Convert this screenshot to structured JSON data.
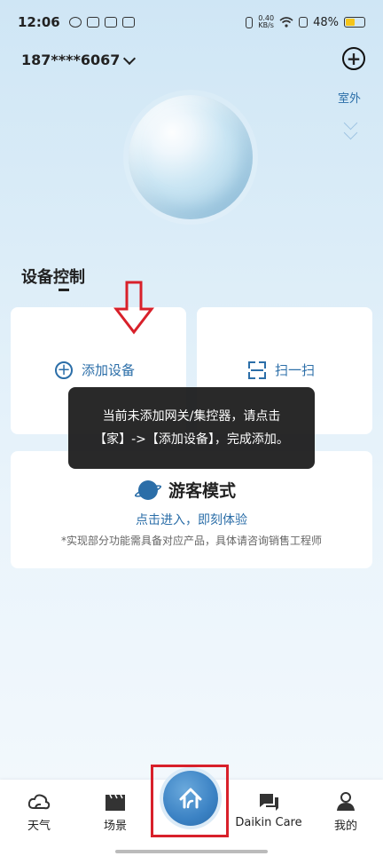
{
  "status_bar": {
    "time": "12:06",
    "net_speed_value": "0.40",
    "net_speed_unit": "KB/s",
    "battery": "48%"
  },
  "header": {
    "account": "187****6067",
    "outdoor_label": "室外"
  },
  "section": {
    "title": "设备控制"
  },
  "cards": {
    "add_device_label": "添加设备",
    "scan_label": "扫一扫",
    "guest_title": "游客模式",
    "guest_enter": "点击进入，即刻体验",
    "guest_note": "*实现部分功能需具备对应产品，具体请咨询销售工程师"
  },
  "toast": {
    "line1": "当前未添加网关/集控器，请点击",
    "line2": "【家】->【添加设备】，完成添加。"
  },
  "bottom_nav": {
    "weather": "天气",
    "scene": "场景",
    "care": "Daikin Care",
    "me": "我的"
  },
  "colors": {
    "accent": "#2b6ea8",
    "highlight": "#d8202a"
  }
}
